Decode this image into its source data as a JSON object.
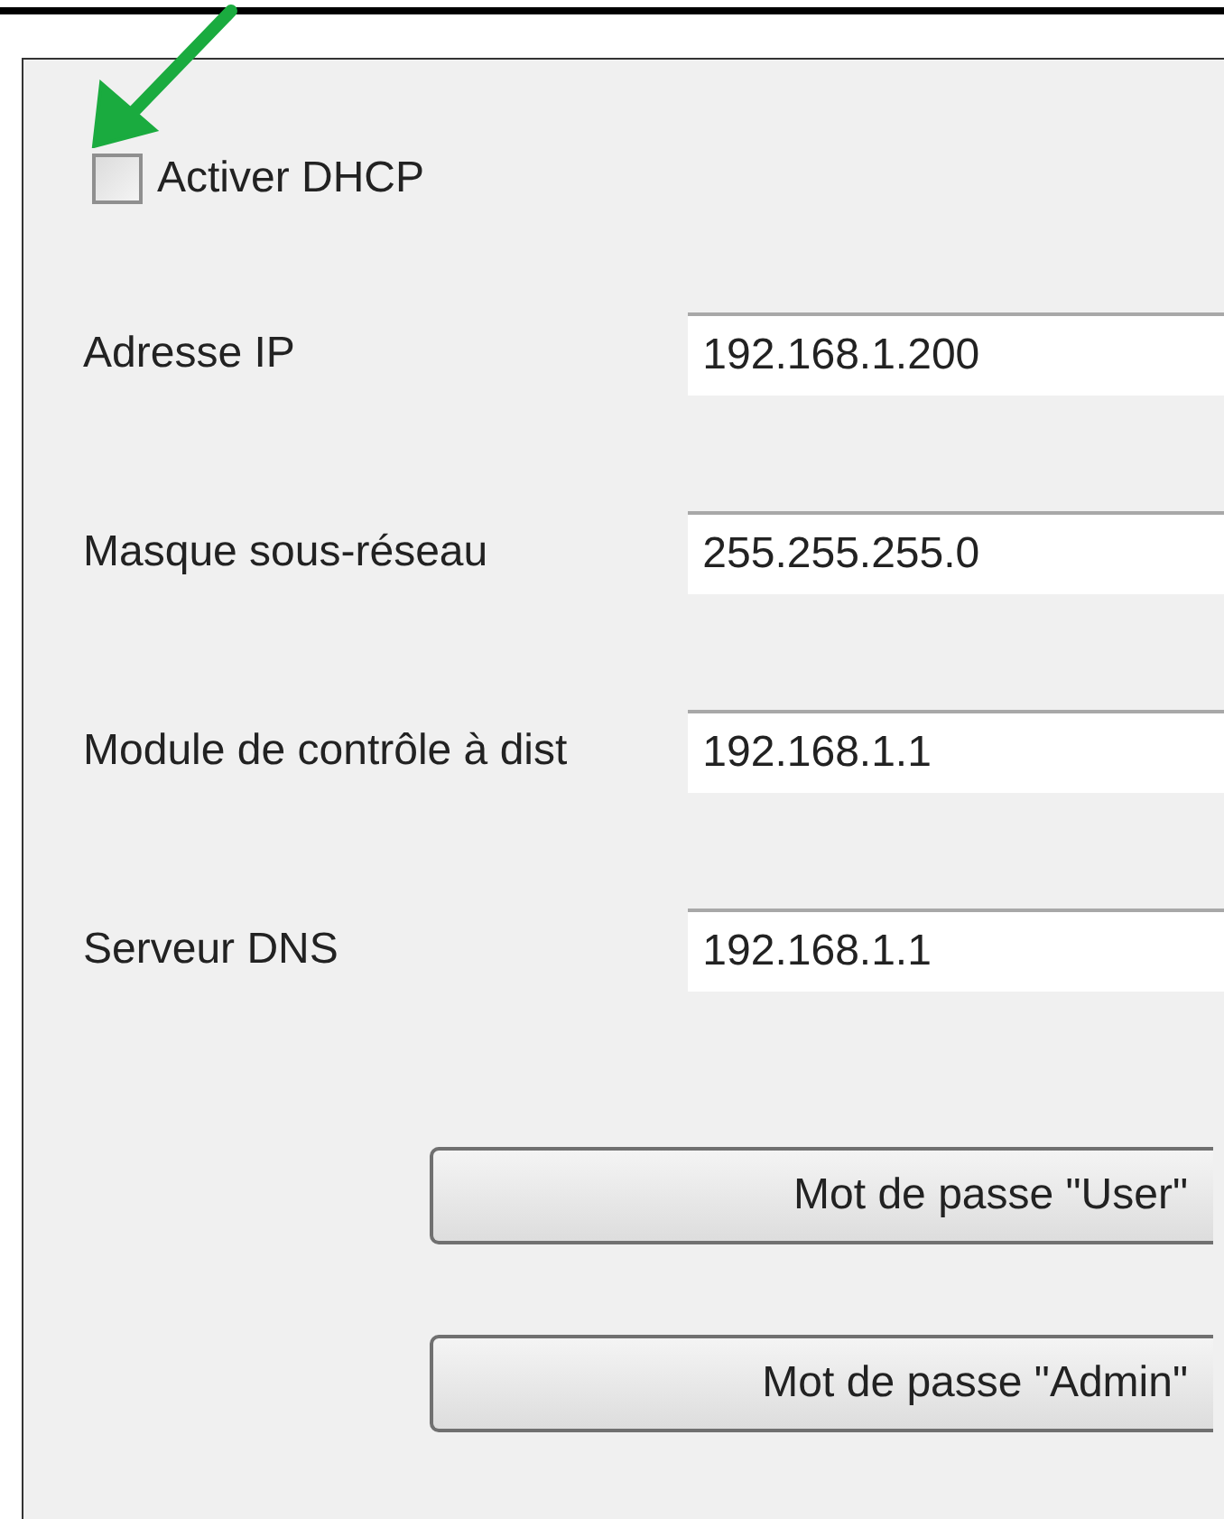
{
  "dhcp": {
    "label": "Activer DHCP",
    "checked": false
  },
  "fields": [
    {
      "label": "Adresse IP",
      "value": "192.168.1.200"
    },
    {
      "label": "Masque sous-réseau",
      "value": "255.255.255.0"
    },
    {
      "label": "Module de contrôle à dist",
      "value": "192.168.1.1"
    },
    {
      "label": "Serveur DNS",
      "value": "192.168.1.1"
    }
  ],
  "buttons": [
    "Mot de passe \"User\"",
    "Mot de passe \"Admin\""
  ]
}
